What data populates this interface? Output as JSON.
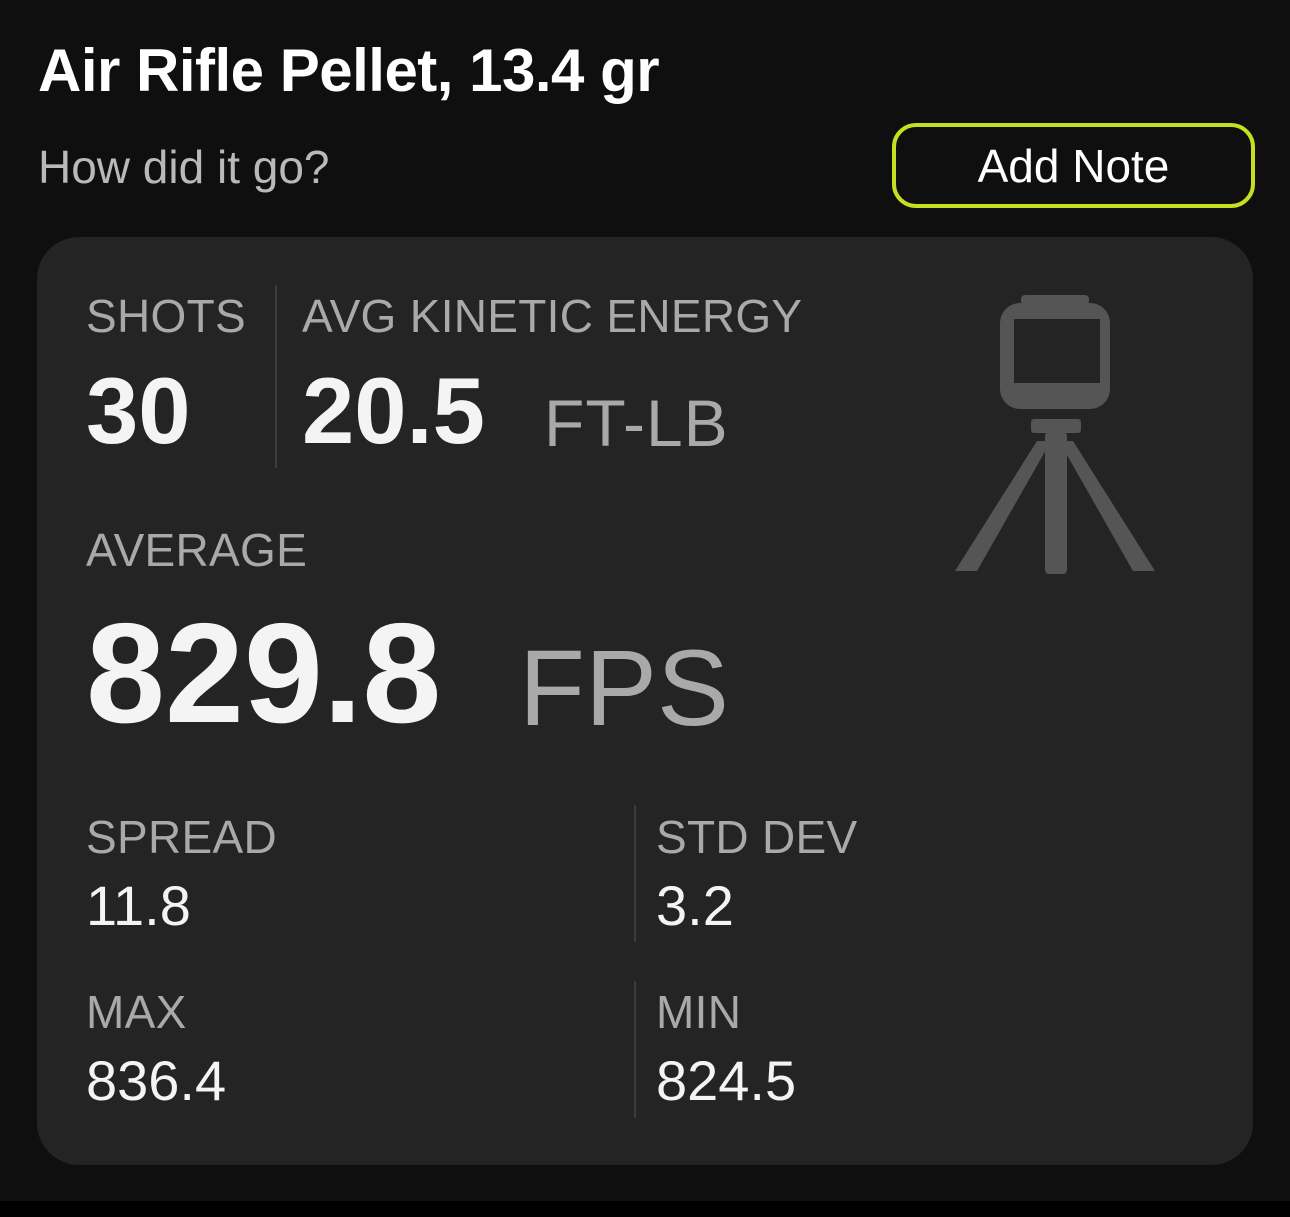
{
  "header": {
    "title": "Air Rifle Pellet, 13.4 gr",
    "prompt": "How did it go?",
    "add_note_label": "Add Note"
  },
  "summary": {
    "shots": {
      "label": "SHOTS",
      "value": "30"
    },
    "avg_ke": {
      "label": "AVG KINETIC ENERGY",
      "value": "20.5",
      "unit": "FT-LB"
    },
    "average": {
      "label": "AVERAGE",
      "value": "829.8",
      "unit": "FPS"
    }
  },
  "stats": {
    "spread": {
      "label": "SPREAD",
      "value": "11.8"
    },
    "std_dev": {
      "label": "STD DEV",
      "value": "3.2"
    },
    "max": {
      "label": "MAX",
      "value": "836.4"
    },
    "min": {
      "label": "MIN",
      "value": "824.5"
    }
  },
  "icons": {
    "device": "chronograph-tripod-icon"
  },
  "colors": {
    "accent": "#c6e01f",
    "background": "#0f0f0f",
    "card": "#242424",
    "label": "#a9a9a9",
    "value": "#f4f4f4",
    "icon": "#555555"
  }
}
